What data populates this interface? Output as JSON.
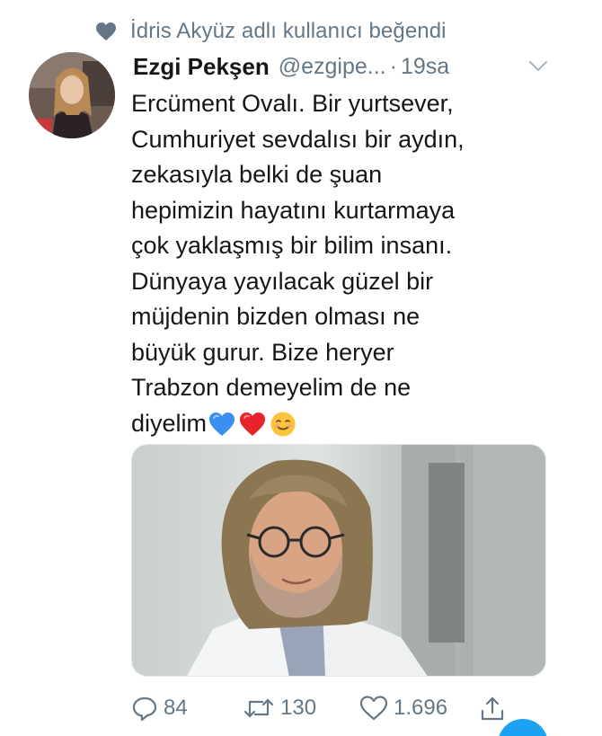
{
  "context": {
    "icon": "heart-icon",
    "text": "İdris Akyüz adlı kullanıcı beğendi"
  },
  "tweet": {
    "display_name": "Ezgi Pekşen",
    "handle": "@ezgipe...",
    "separator": "·",
    "time": "19sa",
    "text": "Ercüment Ovalı. Bir yurtsever,\nCumhuriyet sevdalısı bir aydın,\nzekasıyla belki de şuan\nhepimizin hayatını kurtarmaya\nçok yaklaşmış bir bilim insanı.\nDünyaya yayılacak güzel bir\nmüjdenin bizden olması ne\nbüyük gurur. Bize heryer\nTrabzon demeyelim de ne\ndiyelim",
    "emojis": [
      "blue-heart-emoji",
      "red-heart-emoji",
      "smiling-face-emoji"
    ]
  },
  "actions": {
    "replies": "84",
    "retweets": "130",
    "likes": "1.696"
  },
  "colors": {
    "secondary_text": "#657786",
    "primary_text": "#14171a",
    "accent": "#1da1f2"
  }
}
